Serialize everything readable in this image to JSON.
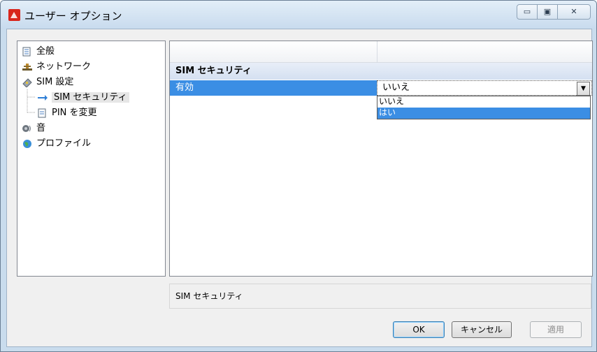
{
  "window": {
    "title": "ユーザー オプション",
    "controls": {
      "minimize": "▭",
      "maximize": "▣",
      "close": "✕"
    }
  },
  "tree": {
    "items": [
      {
        "label": "全般",
        "icon": "general-page-icon"
      },
      {
        "label": "ネットワーク",
        "icon": "network-icon"
      },
      {
        "label": "SIM 設定",
        "icon": "sim-card-icon"
      },
      {
        "label": "SIM セキュリティ",
        "icon": "arrow-right-icon",
        "selected": true
      },
      {
        "label": "PIN を変更",
        "icon": "page-icon"
      },
      {
        "label": "音",
        "icon": "speaker-icon"
      },
      {
        "label": "プロファイル",
        "icon": "globe-icon"
      }
    ]
  },
  "grid": {
    "category": "SIM セキュリティ",
    "property": {
      "name": "有効",
      "value": "いいえ"
    },
    "dropdown_options": [
      {
        "label": "いいえ",
        "highlighted": false
      },
      {
        "label": "はい",
        "highlighted": true
      }
    ]
  },
  "description": "SIM セキュリティ",
  "buttons": {
    "ok": "OK",
    "cancel": "キャンセル",
    "apply": "適用"
  },
  "colors": {
    "selection": "#3b8ee4",
    "title_bar": "#c8dbee"
  }
}
